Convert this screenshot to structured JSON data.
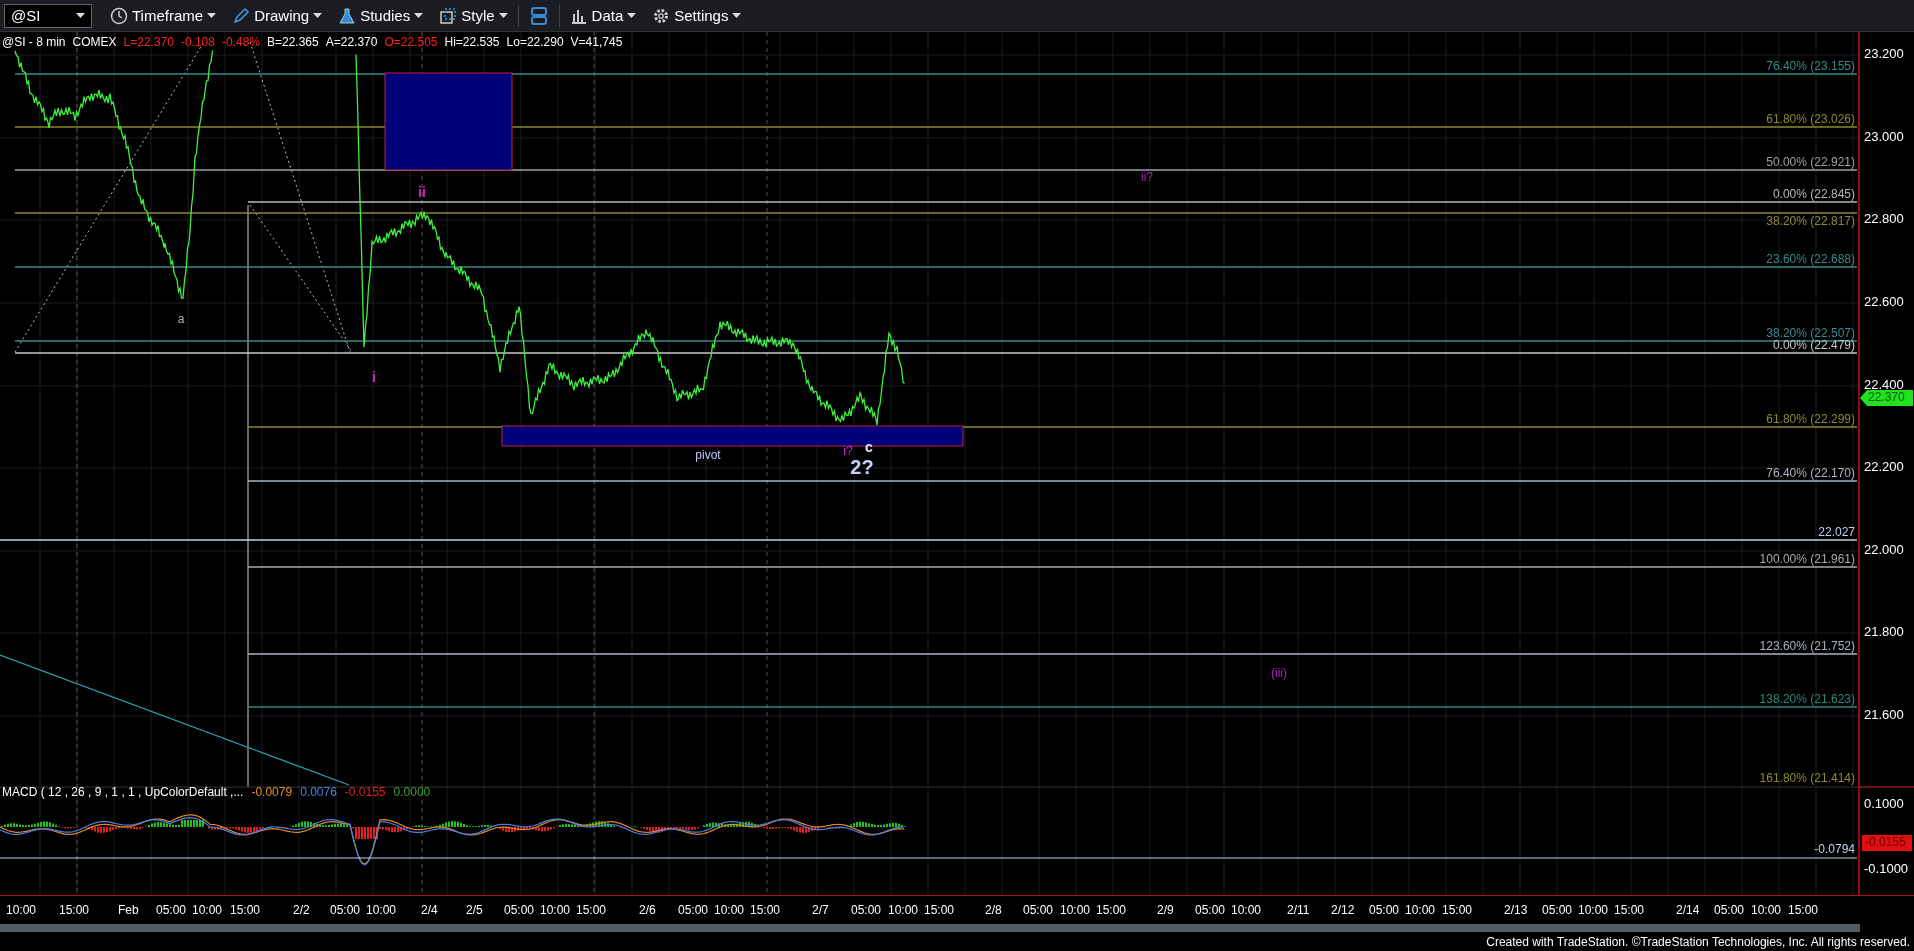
{
  "toolbar": {
    "symbol": "@SI",
    "menus": [
      {
        "kind": "clock",
        "label": "Timeframe"
      },
      {
        "kind": "pencil",
        "label": "Drawing"
      },
      {
        "kind": "flask",
        "label": "Studies"
      },
      {
        "kind": "style",
        "label": "Style"
      },
      {
        "kind": "layout"
      },
      {
        "kind": "bars",
        "label": "Data"
      },
      {
        "kind": "gear",
        "label": "Settings"
      }
    ]
  },
  "quote_line": [
    {
      "text": "@SI - 8 min",
      "color": "#ffffff"
    },
    {
      "text": "COMEX",
      "color": "#ffffff"
    },
    {
      "text": "L=22.370",
      "color": "#ff2020"
    },
    {
      "text": "-0.108",
      "color": "#ff2020"
    },
    {
      "text": "-0.48%",
      "color": "#ff2020"
    },
    {
      "text": "B=22.365",
      "color": "#ffffff"
    },
    {
      "text": "A=22.370",
      "color": "#ffffff"
    },
    {
      "text": "O=22.505",
      "color": "#ff2020"
    },
    {
      "text": "Hi=22.535",
      "color": "#ffffff"
    },
    {
      "text": "Lo=22.290",
      "color": "#ffffff"
    },
    {
      "text": "V=41,745",
      "color": "#ffffff"
    }
  ],
  "fib_levels": [
    {
      "label": "76.40% (23.155)",
      "color": "#3a8a8a"
    },
    {
      "label": "61.80% (23.026)",
      "color": "#8a8a30"
    },
    {
      "label": "50.00% (22.921)",
      "color": "#a0a0a0"
    },
    {
      "label": "0.00% (22.845)",
      "color": "#b8b8b8"
    },
    {
      "label": "38.20% (22.817)",
      "color": "#8a8a30"
    },
    {
      "label": "23.60% (22.688)",
      "color": "#3a8a8a"
    },
    {
      "label": "38.20% (22.507)",
      "color": "#3a8a8a"
    },
    {
      "label": "0.00% (22.479)",
      "color": "#c8c8c8"
    },
    {
      "label": "61.80% (22.299)",
      "color": "#8a8a30"
    },
    {
      "label": "76.40% (22.170)",
      "color": "#a8b4c0"
    },
    {
      "label": "22.027",
      "color": "#c0d0e8"
    },
    {
      "label": "100.00% (21.961)",
      "color": "#a8a8a8"
    },
    {
      "label": "123.60% (21.752)",
      "color": "#a8b4c0"
    },
    {
      "label": "138.20% (21.623)",
      "color": "#2a8a7a"
    },
    {
      "label": "161.80% (21.414)",
      "color": "#8a8a30"
    }
  ],
  "wave_labels": [
    {
      "text": "a",
      "color": "#a8b0c8"
    },
    {
      "text": "i",
      "color": "#d020d0"
    },
    {
      "text": "ii",
      "color": "#d020d0"
    },
    {
      "text": "ii?",
      "color": "#b020b0"
    },
    {
      "text": "pivot",
      "color": "#c0c8ff"
    },
    {
      "text": "i?",
      "color": "#d020d0"
    },
    {
      "text": "c",
      "color": "#e0e8ff"
    },
    {
      "text": "2?",
      "color": "#c8d0ff"
    },
    {
      "text": "(iii)",
      "color": "#b020b0"
    }
  ],
  "price_axis": [
    "23.200",
    "23.000",
    "22.800",
    "22.600",
    "22.400",
    "22.200",
    "22.000",
    "21.800",
    "21.600"
  ],
  "last_price": "22.370",
  "macd": {
    "label": "MACD ( 12 , 26 , 9 , 1 , 1 , UpColorDefault ,...",
    "values": [
      {
        "text": "-0.0079",
        "color": "#e08a30"
      },
      {
        "text": "0.0076",
        "color": "#4a80e0"
      },
      {
        "text": "-0.0155",
        "color": "#e02020"
      },
      {
        "text": "0.0000",
        "color": "#30a030"
      }
    ],
    "axis": [
      "0.1000",
      "-0.1000"
    ],
    "level_label": "-0.0794",
    "last_value": "-0.0155"
  },
  "time_axis": [
    "10:00",
    "15:00",
    "Feb",
    "05:00",
    "10:00",
    "15:00",
    "2/2",
    "05:00",
    "10:00",
    "2/4",
    "2/5",
    "05:00",
    "10:00",
    "15:00",
    "2/6",
    "05:00",
    "10:00",
    "15:00",
    "2/7",
    "05:00",
    "10:00",
    "15:00",
    "2/8",
    "05:00",
    "10:00",
    "15:00",
    "2/9",
    "05:00",
    "10:00",
    "2/11",
    "2/12",
    "05:00",
    "10:00",
    "15:00",
    "2/13",
    "05:00",
    "10:00",
    "15:00",
    "2/14",
    "05:00",
    "10:00",
    "15:00"
  ],
  "footer": "Created with TradeStation. ©TradeStation Technologies, Inc. All rights reserved."
}
